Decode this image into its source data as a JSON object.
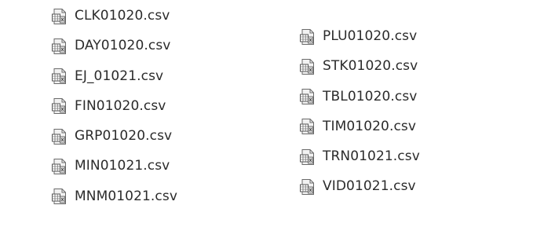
{
  "files": {
    "column1": [
      {
        "name": "CLK01020.csv",
        "icon": "spreadsheet-file-icon"
      },
      {
        "name": "DAY01020.csv",
        "icon": "spreadsheet-file-icon"
      },
      {
        "name": "EJ_01021.csv",
        "icon": "spreadsheet-file-icon"
      },
      {
        "name": "FIN01020.csv",
        "icon": "spreadsheet-file-icon"
      },
      {
        "name": "GRP01020.csv",
        "icon": "spreadsheet-file-icon"
      },
      {
        "name": "MIN01021.csv",
        "icon": "spreadsheet-file-icon"
      },
      {
        "name": "MNM01021.csv",
        "icon": "spreadsheet-file-icon"
      }
    ],
    "column2": [
      {
        "name": "PLU01020.csv",
        "icon": "spreadsheet-file-icon"
      },
      {
        "name": "STK01020.csv",
        "icon": "spreadsheet-file-icon"
      },
      {
        "name": "TBL01020.csv",
        "icon": "spreadsheet-file-icon"
      },
      {
        "name": "TIM01020.csv",
        "icon": "spreadsheet-file-icon"
      },
      {
        "name": "TRN01021.csv",
        "icon": "spreadsheet-file-icon"
      },
      {
        "name": "VID01021.csv",
        "icon": "spreadsheet-file-icon"
      }
    ]
  },
  "colors": {
    "text": "#2b2b2b",
    "icon_border": "#6b6b6b",
    "icon_fill": "#f2f2f2"
  }
}
